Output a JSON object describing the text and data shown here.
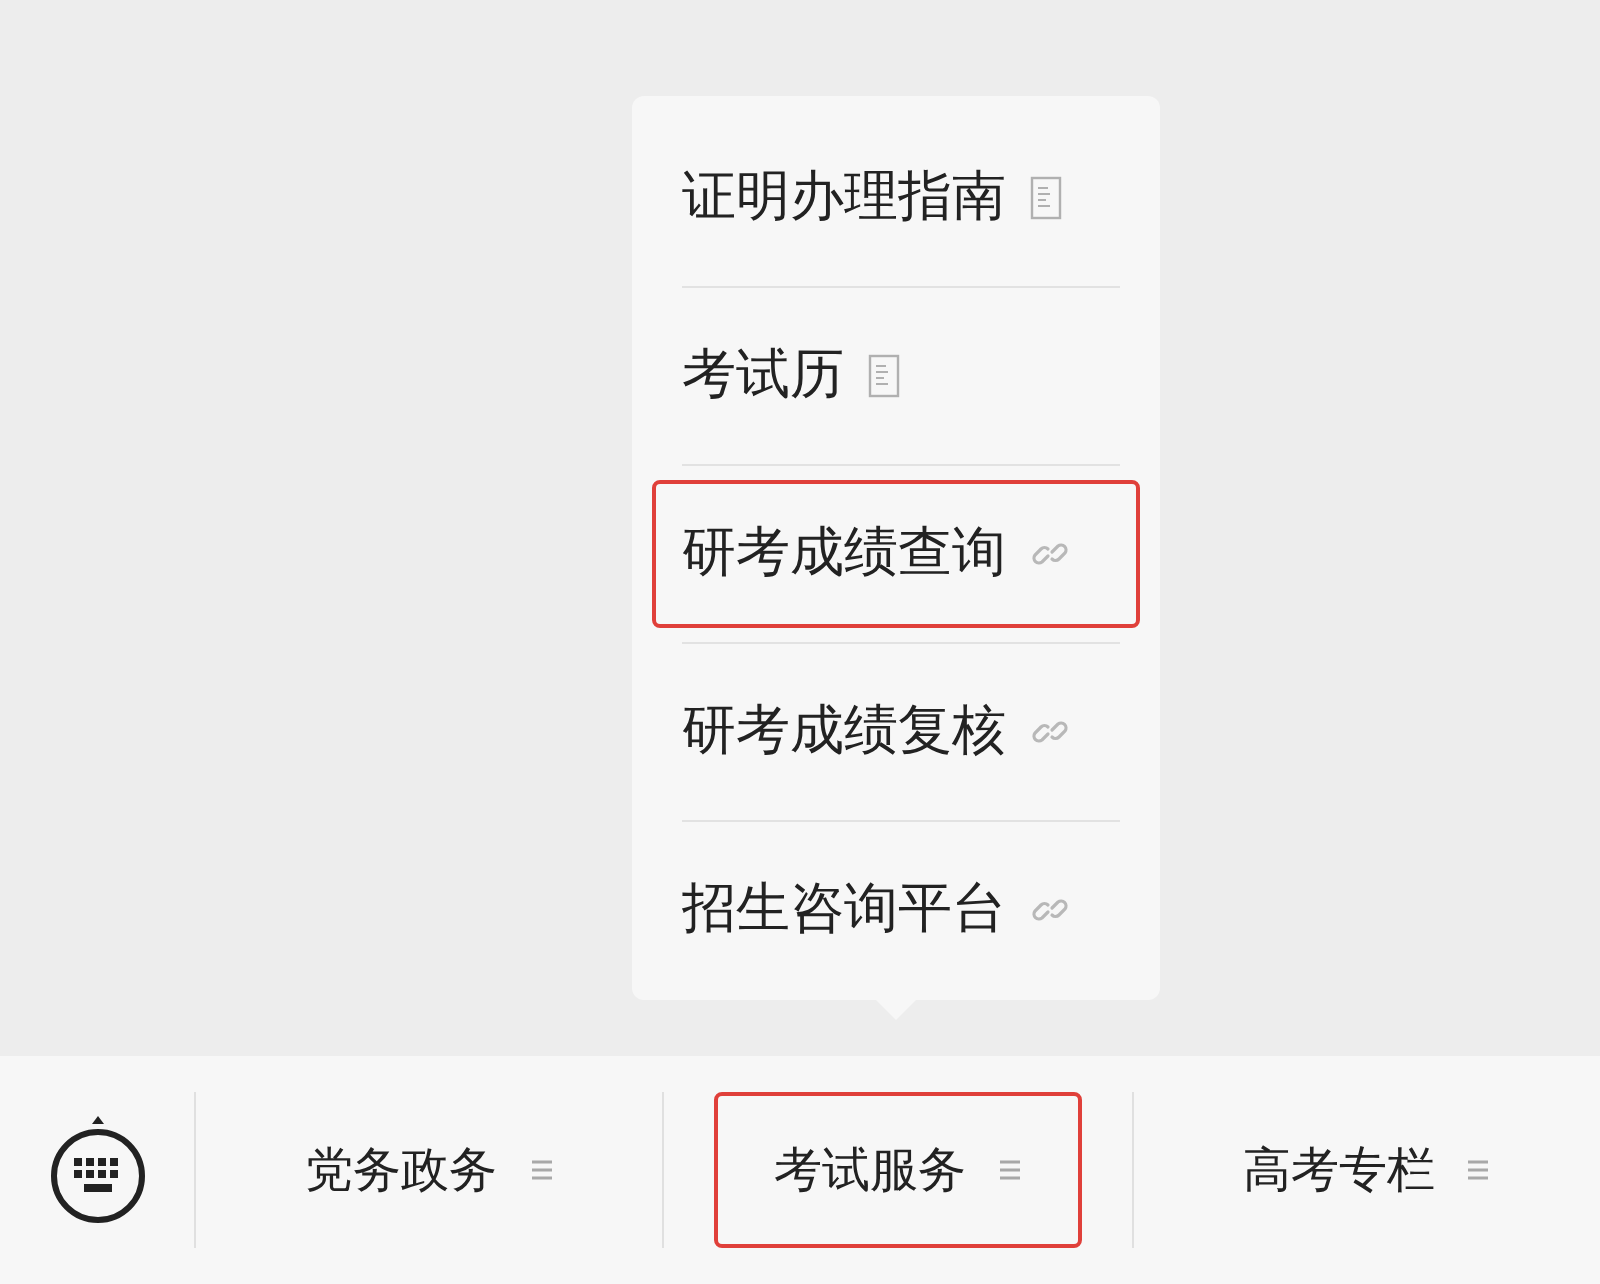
{
  "submenu": {
    "items": [
      {
        "label": "证明办理指南",
        "kind": "article",
        "highlighted": false
      },
      {
        "label": "考试历",
        "kind": "article",
        "highlighted": false
      },
      {
        "label": "研考成绩查询",
        "kind": "link",
        "highlighted": true
      },
      {
        "label": "研考成绩复核",
        "kind": "link",
        "highlighted": false
      },
      {
        "label": "招生咨询平台",
        "kind": "link",
        "highlighted": false
      }
    ]
  },
  "menu_bar": {
    "tabs": [
      {
        "label": "党务政务",
        "highlighted": false
      },
      {
        "label": "考试服务",
        "highlighted": true
      },
      {
        "label": "高考专栏",
        "highlighted": false
      }
    ]
  }
}
